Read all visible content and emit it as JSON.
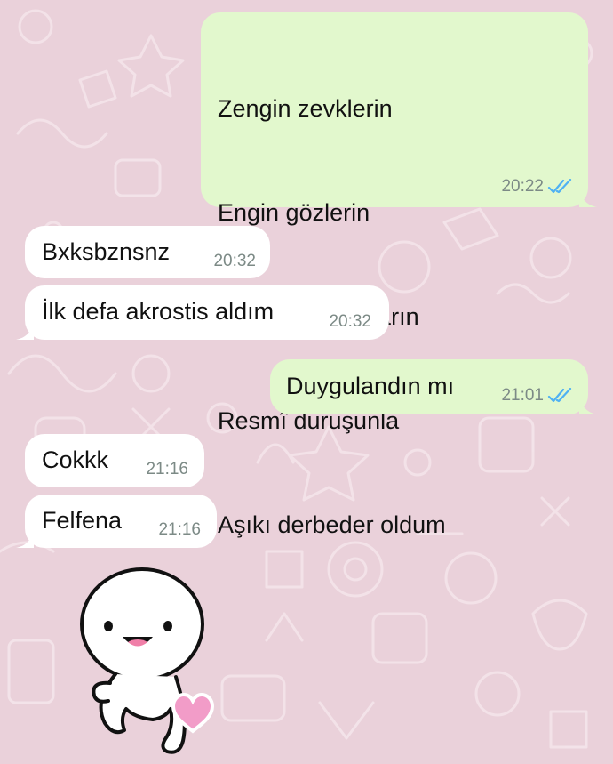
{
  "colors": {
    "wallpaper": "#ead1da",
    "outgoing_bubble": "#e2f8cd",
    "incoming_bubble": "#ffffff",
    "read_ticks": "#4fb1f3",
    "timestamp": "#7c8a86"
  },
  "messages": [
    {
      "direction": "outgoing",
      "lines": [
        "Zengin zevklerin",
        "Engin gözlerin",
        "Hararetli bakışların",
        "Resmî duruşunla",
        "Aşıkı derbeder oldum"
      ],
      "time": "20:22",
      "status": "read"
    },
    {
      "direction": "incoming",
      "text": "Bxksbznsnz",
      "time": "20:32"
    },
    {
      "direction": "incoming",
      "text": "İlk defa akrostis aldım",
      "time": "20:32"
    },
    {
      "direction": "outgoing",
      "text": "Duygulandın mı",
      "time": "21:01",
      "status": "read"
    },
    {
      "direction": "incoming",
      "text": "Cokkk",
      "time": "21:16"
    },
    {
      "direction": "incoming",
      "text": "Felfena",
      "time": "21:16"
    }
  ],
  "sticker": {
    "name": "white-blob-character-with-heart-sticker"
  },
  "icons": [
    "double-check-read-icon",
    "sticker-heart-icon"
  ]
}
